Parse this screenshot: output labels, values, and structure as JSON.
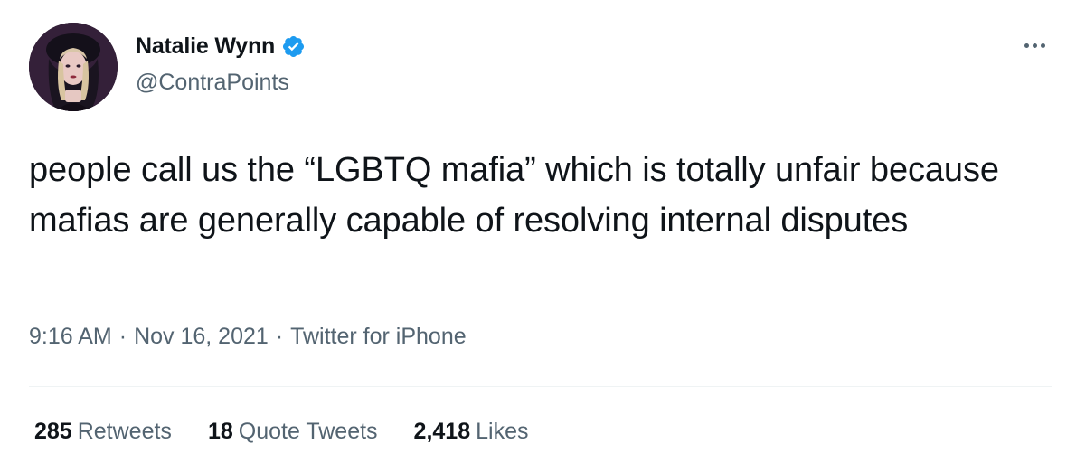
{
  "author": {
    "display_name": "Natalie Wynn",
    "handle": "@ContraPoints",
    "verified": true,
    "avatar_icon": "profile-photo"
  },
  "tweet": {
    "text": "people call us the “LGBTQ mafia” which is totally unfair because mafias are generally capable of resolving internal disputes",
    "time": "9:16 AM",
    "date": "Nov 16, 2021",
    "source": "Twitter for iPhone",
    "separator": "·"
  },
  "stats": {
    "retweets": {
      "count": "285",
      "label": "Retweets"
    },
    "quotes": {
      "count": "18",
      "label": "Quote Tweets"
    },
    "likes": {
      "count": "2,418",
      "label": "Likes"
    }
  },
  "colors": {
    "primary_text": "#0f1419",
    "secondary_text": "#536471",
    "verified_badge": "#1d9bf0",
    "divider": "#eff3f4"
  },
  "icons": {
    "verified": "verified-badge-icon",
    "more": "more-options-icon"
  }
}
